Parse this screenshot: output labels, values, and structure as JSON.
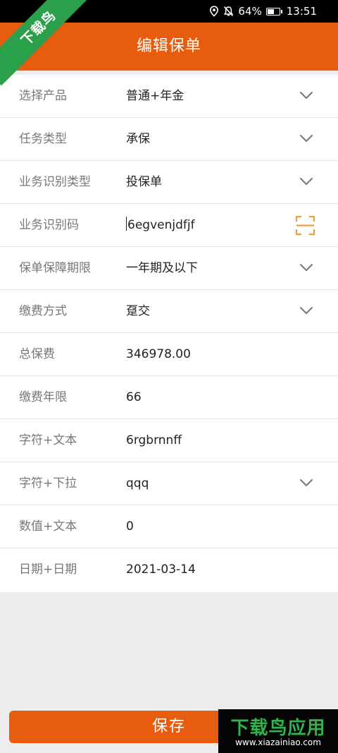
{
  "status_bar": {
    "battery": "64%",
    "battery_level": 0.64,
    "time": "13:51"
  },
  "header": {
    "title": "编辑保单"
  },
  "form": {
    "rows": [
      {
        "label": "选择产品",
        "value": "普通+年金",
        "control": "dropdown"
      },
      {
        "label": "任务类型",
        "value": "承保",
        "control": "dropdown"
      },
      {
        "label": "业务识别类型",
        "value": "投保单",
        "control": "dropdown"
      },
      {
        "label": "业务识别码",
        "value": "6egvenjdfjf",
        "control": "scan"
      },
      {
        "label": "保单保障期限",
        "value": "一年期及以下",
        "control": "dropdown"
      },
      {
        "label": "缴费方式",
        "value": "趸交",
        "control": "dropdown"
      },
      {
        "label": "总保费",
        "value": "346978.00",
        "control": "text"
      },
      {
        "label": "缴费年限",
        "value": "66",
        "control": "text"
      },
      {
        "label": "字符+文本",
        "value": "6rgbrnnff",
        "control": "text"
      },
      {
        "label": "字符+下拉",
        "value": "qqq",
        "control": "dropdown"
      },
      {
        "label": "数值+文本",
        "value": "0",
        "control": "text"
      },
      {
        "label": "日期+日期",
        "value": "2021-03-14",
        "control": "date"
      }
    ]
  },
  "save_button": {
    "label": "保存"
  },
  "watermarks": {
    "corner": "下载鸟",
    "main": "下载鸟应用",
    "url": "www.xiazainiao.com"
  },
  "colors": {
    "accent": "#e85c0d",
    "background": "#ececec"
  }
}
